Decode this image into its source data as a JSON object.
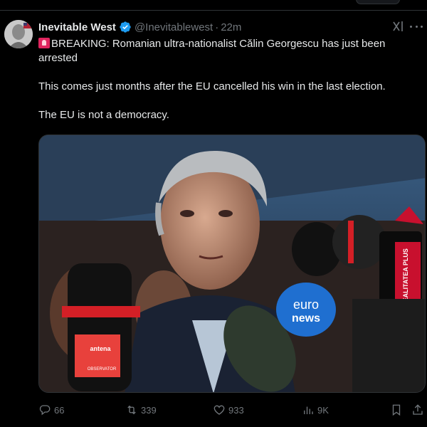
{
  "author": {
    "display_name": "Inevitable West",
    "handle": "@Inevitablewest",
    "separator": "·",
    "time": "22m"
  },
  "tweet": {
    "line_1": "BREAKING: Romanian ultra-nationalist Călin Georgescu has just been arrested",
    "line_2": "This comes just months after the EU cancelled his win in the last election.",
    "line_3": "The EU is not a democracy."
  },
  "media": {
    "mic_brand_1": "antena",
    "mic_brand_2": "OBSERVATOR",
    "mic_brand_3": "euro",
    "mic_brand_4": "news",
    "mic_brand_5": "REALITATEA PLUS"
  },
  "actions": {
    "replies": "66",
    "reposts": "339",
    "likes": "933",
    "views": "9K"
  },
  "icons": {
    "verified": "verified-badge-icon",
    "grok": "grok-icon",
    "more": "more-icon",
    "reply": "reply-icon",
    "repost": "repost-icon",
    "like": "like-icon",
    "views": "views-icon",
    "bookmark": "bookmark-icon",
    "share": "share-icon"
  },
  "colors": {
    "background": "#000000",
    "text": "#e7e9ea",
    "secondary": "#71767b",
    "verified": "#1d9bf0",
    "border": "#2f3336"
  }
}
